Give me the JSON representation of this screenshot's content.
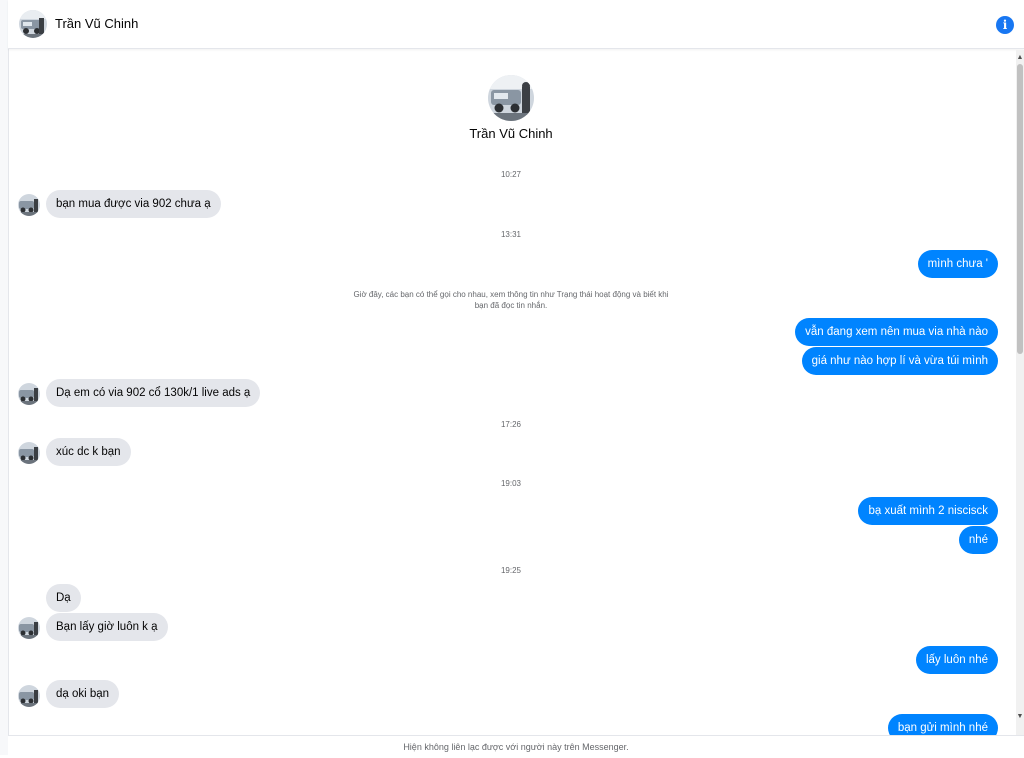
{
  "header": {
    "contact_name": "Trần Vũ Chinh",
    "info_icon": "info-icon"
  },
  "profile": {
    "name": "Trần Vũ Chinh"
  },
  "notice": "Giờ đây, các bạn có thể gọi cho nhau, xem thông tin như Trạng thái hoạt động và biết khi bạn đã đọc tin nhắn.",
  "timestamps": [
    "10:27",
    "13:31",
    "17:26",
    "19:03",
    "19:25"
  ],
  "messages": [
    {
      "side": "in",
      "text": "bạn mua được via 902 chưa ạ"
    },
    {
      "side": "out",
      "text": "mình chưa '"
    },
    {
      "side": "out",
      "text": "vẫn đang xem nên mua via nhà nào"
    },
    {
      "side": "out",
      "text": "giá như nào hợp lí và vừa túi mình"
    },
    {
      "side": "in",
      "text": "Dạ em có via 902 cổ 130k/1 live ads ạ"
    },
    {
      "side": "in",
      "text": "xúc dc k bạn"
    },
    {
      "side": "out",
      "text": "bạ xuất mình 2 niscisck"
    },
    {
      "side": "out",
      "text": "nhé"
    },
    {
      "side": "in",
      "text": "Dạ"
    },
    {
      "side": "in",
      "text": "Bạn lấy giờ luôn k ạ"
    },
    {
      "side": "out",
      "text": "lấy luôn nhé"
    },
    {
      "side": "in",
      "text": "dạ oki bạn"
    },
    {
      "side": "out",
      "text": "bạn gửi mình nhé"
    }
  ],
  "footer": "Hiện không liên lạc được với người này trên Messenger.",
  "colors": {
    "outgoing": "#0084ff",
    "incoming": "#e4e6eb",
    "accent": "#1877f2"
  }
}
